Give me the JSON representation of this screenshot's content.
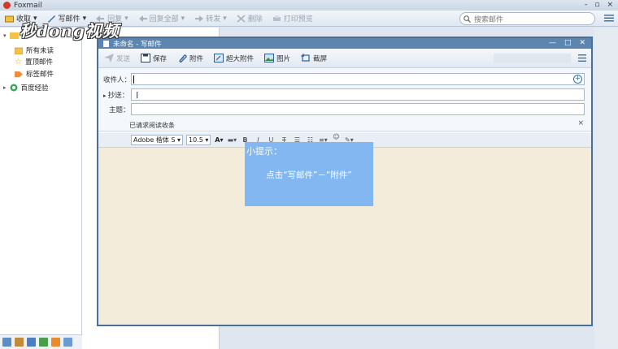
{
  "app": {
    "title": "Foxmail",
    "window_controls": [
      "-",
      "▫",
      "×"
    ]
  },
  "main_toolbar": [
    {
      "label": "收取",
      "icon": "inbox-icon",
      "disabled": false
    },
    {
      "label": "写邮件",
      "icon": "compose-icon",
      "disabled": false
    },
    {
      "label": "回复",
      "icon": "reply-icon",
      "disabled": true
    },
    {
      "label": "回复全部",
      "icon": "reply-all-icon",
      "disabled": true
    },
    {
      "label": "转发",
      "icon": "forward-icon",
      "disabled": true
    },
    {
      "label": "删除",
      "icon": "delete-icon",
      "disabled": true
    },
    {
      "label": "打印预览",
      "icon": "print-icon",
      "disabled": true
    }
  ],
  "search": {
    "placeholder": "搜索邮件"
  },
  "watermark": "秒dong视频",
  "sidebar": {
    "items": [
      {
        "label": "所有未读",
        "icon": "folder-icon"
      },
      {
        "label": "置顶邮件",
        "icon": "star-icon"
      },
      {
        "label": "标签邮件",
        "icon": "tag-icon"
      }
    ],
    "group": {
      "label": "百度经验",
      "icon": "account-icon"
    }
  },
  "compose": {
    "title": "未命名 - 写邮件",
    "window_controls": [
      "—",
      "□",
      "✕"
    ],
    "toolbar": [
      {
        "label": "发送",
        "icon": "send-icon",
        "disabled": true
      },
      {
        "label": "保存",
        "icon": "save-icon",
        "disabled": false
      },
      {
        "label": "附件",
        "icon": "attachment-icon",
        "disabled": false
      },
      {
        "label": "超大附件",
        "icon": "large-attachment-icon",
        "disabled": false
      },
      {
        "label": "图片",
        "icon": "image-icon",
        "disabled": false
      },
      {
        "label": "截屏",
        "icon": "screenshot-icon",
        "disabled": false
      }
    ],
    "to_label": "收件人：",
    "cc_label": "抄送：",
    "subject_label": "主题：",
    "receipt_text": "已请求阅读收条",
    "receipt_close": "×",
    "font_family": "Adobe 楷体 S",
    "font_size": "10.5"
  },
  "tip": {
    "title": "小提示：",
    "text": "点击“写邮件”－“附件”"
  },
  "colors": {
    "titlebar": "#5c85b0",
    "tip_bg": "#82b7f2",
    "editor_bg": "#f4ecdb"
  }
}
